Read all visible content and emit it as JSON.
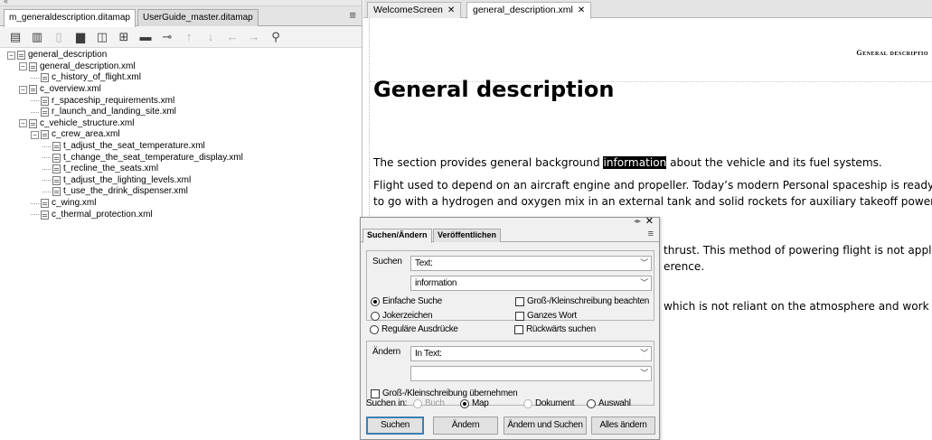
{
  "left_panel": {
    "tabs": [
      "m_generaldescription.ditamap",
      "UserGuide_master.ditamap"
    ],
    "tree": [
      {
        "label": "general_description",
        "depth": 0,
        "toggle": "−"
      },
      {
        "label": "general_description.xml",
        "depth": 1,
        "toggle": "−"
      },
      {
        "label": "c_history_of_flight.xml",
        "depth": 2,
        "toggle": ""
      },
      {
        "label": "c_overview.xml",
        "depth": 1,
        "toggle": "−"
      },
      {
        "label": "r_spaceship_requirements.xml",
        "depth": 2,
        "toggle": ""
      },
      {
        "label": "r_launch_and_landing_site.xml",
        "depth": 2,
        "toggle": ""
      },
      {
        "label": "c_vehicle_structure.xml",
        "depth": 1,
        "toggle": "−"
      },
      {
        "label": "c_crew_area.xml",
        "depth": 2,
        "toggle": "−"
      },
      {
        "label": "t_adjust_the_seat_temperature.xml",
        "depth": 3,
        "toggle": ""
      },
      {
        "label": "t_change_the_seat_temperature_display.xml",
        "depth": 3,
        "toggle": ""
      },
      {
        "label": "t_recline_the_seats.xml",
        "depth": 3,
        "toggle": ""
      },
      {
        "label": "t_adjust_the_lighting_levels.xml",
        "depth": 3,
        "toggle": ""
      },
      {
        "label": "t_use_the_drink_dispenser.xml",
        "depth": 3,
        "toggle": ""
      },
      {
        "label": "c_wing.xml",
        "depth": 2,
        "toggle": ""
      },
      {
        "label": "c_thermal_protection.xml",
        "depth": 2,
        "toggle": ""
      }
    ]
  },
  "editor": {
    "tabs": [
      "WelcomeScreen",
      "general_description.xml"
    ],
    "running_header": "General descriptio",
    "title": "General description",
    "p1_before": "The section provides general background ",
    "p1_highlight": "information",
    "p1_after": " about the vehicle and its fuel systems.",
    "p2_line1": "Flight used to depend on an aircraft engine and propeller. Today’s modern Personal spaceship is ready",
    "p2_line2": "to go with a hydrogen and oxygen mix in an external tank and solid rockets for auxiliary takeoff power.",
    "p3_line1": "thrust. This method of powering flight is not appli",
    "p3_line2": "erence.",
    "p4_line1": "which is not reliant on the atmosphere and work"
  },
  "dialog": {
    "tabs": [
      "Suchen/Ändern",
      "Veröffentlichen"
    ],
    "search_label": "Suchen",
    "search_type": "Text:",
    "search_value": "information",
    "opt_simple": "Einfache Suche",
    "opt_wildcards": "Jokerzeichen",
    "opt_regex": "Reguläre Ausdrücke",
    "chk_case": "Groß-/Kleinschreibung beachten",
    "chk_whole": "Ganzes Wort",
    "chk_back": "Rückwärts suchen",
    "replace_label": "Ändern",
    "replace_type": "In Text:",
    "replace_value": "",
    "chk_keepcase": "Groß-/Kleinschreibung übernehmen",
    "scope_label": "Suchen in:",
    "scope_book": "Buch",
    "scope_map": "Map",
    "scope_doc": "Dokument",
    "scope_sel": "Auswahl",
    "btn_search": "Suchen",
    "btn_replace": "Ändern",
    "btn_replace_search": "Ändern und Suchen",
    "btn_replace_all": "Alles ändern"
  }
}
